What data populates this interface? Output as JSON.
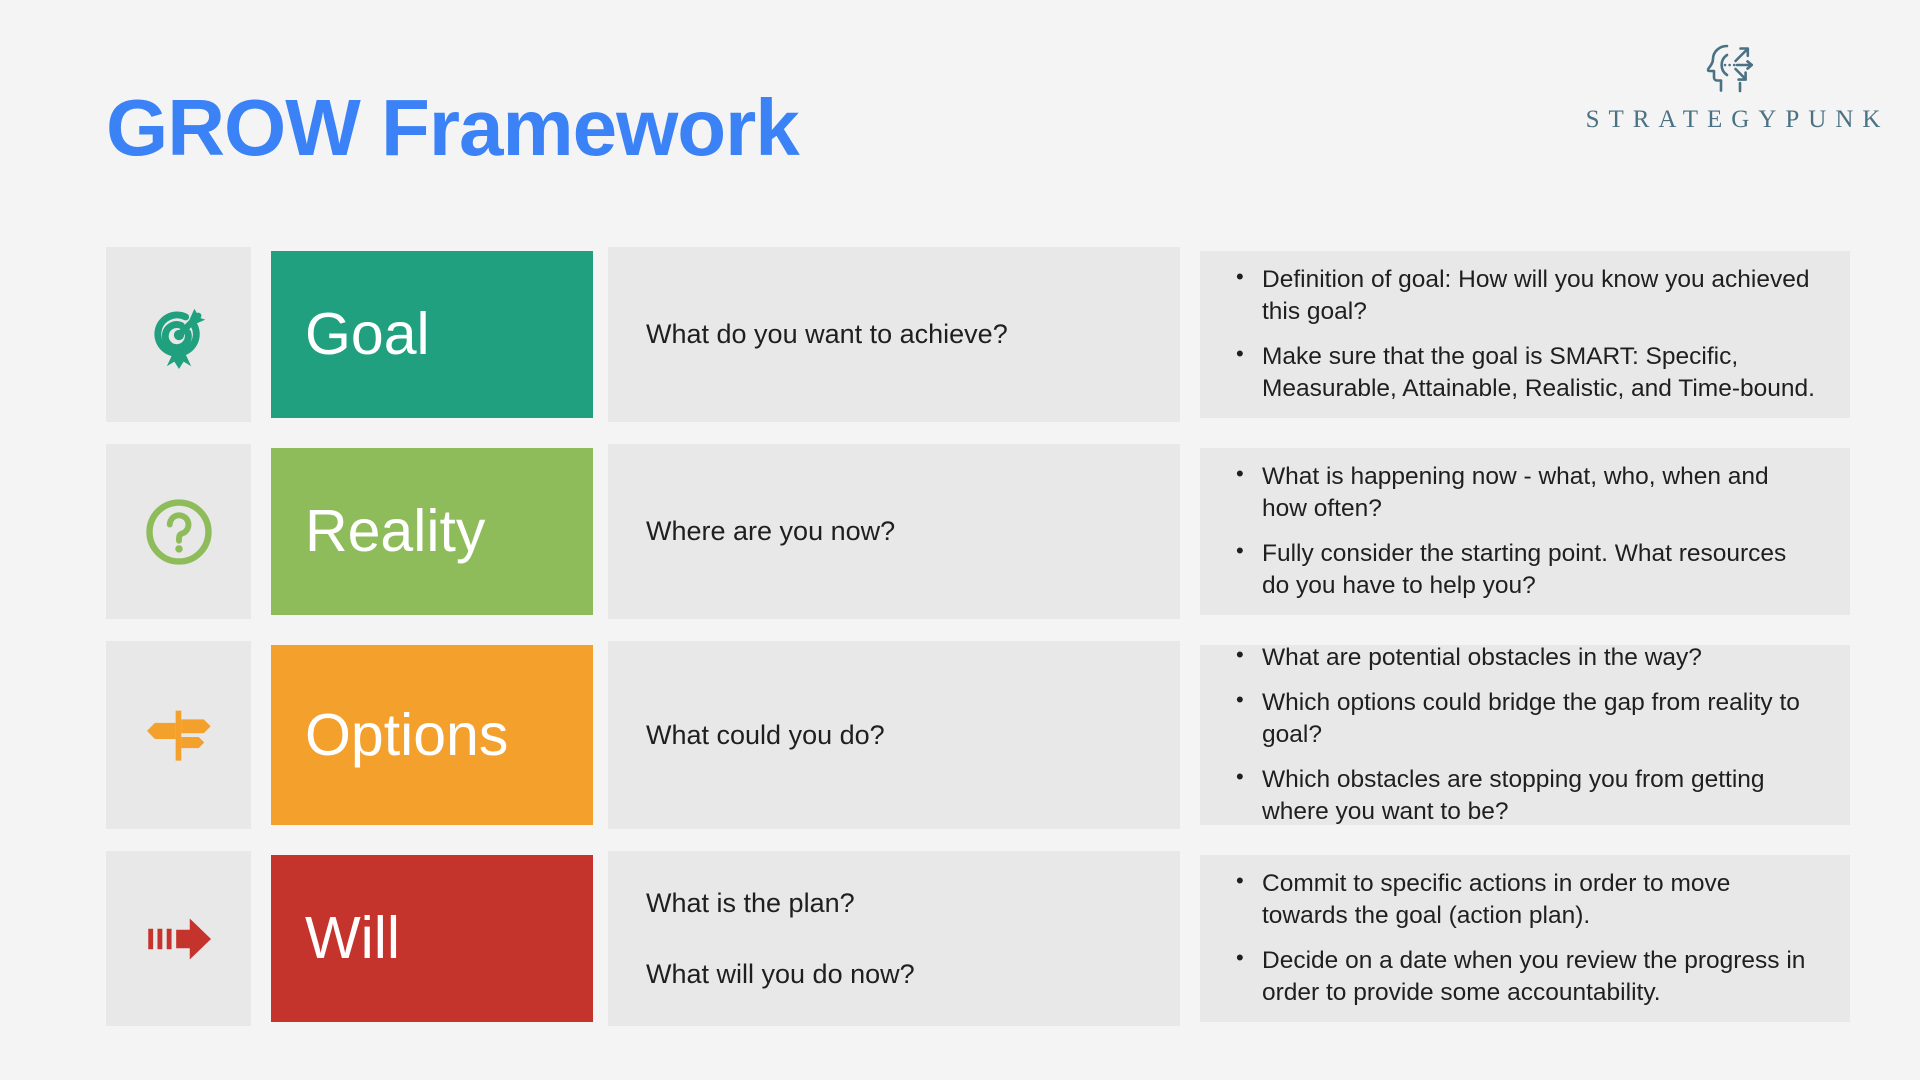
{
  "header": {
    "title": "GROW Framework",
    "title_color": "#3b82f6",
    "brand_name": "STRATEGYPUNK",
    "brand_color": "#4a7184",
    "brand_icon": "head-with-arrows-icon"
  },
  "page": {
    "background_color": "#f4f4f4",
    "panel_color": "#e8e8e8"
  },
  "rows": [
    {
      "key": "goal",
      "label": "Goal",
      "color": "#20a07e",
      "icon": "target-arrow-icon",
      "questions": [
        "What do you want to achieve?"
      ],
      "bullets": [
        "Definition of goal: How will you know you achieved this goal?",
        "Make sure that the goal is SMART: Specific, Measurable, Attainable, Realistic, and Time-bound."
      ]
    },
    {
      "key": "reality",
      "label": "Reality",
      "color": "#8fbc5a",
      "icon": "question-mark-circle-icon",
      "questions": [
        "Where are you now?"
      ],
      "bullets": [
        "What is happening now - what, who, when and how often?",
        "Fully consider the starting point. What resources do you have to help you?"
      ]
    },
    {
      "key": "options",
      "label": "Options",
      "color": "#f3a02c",
      "icon": "signpost-icon",
      "questions": [
        "What could you do?"
      ],
      "bullets": [
        "What are potential obstacles in the way?",
        "Which options could bridge the gap from reality to goal?",
        "Which obstacles are stopping you from getting where you want to be?"
      ]
    },
    {
      "key": "will",
      "label": "Will",
      "color": "#c5342c",
      "icon": "motion-arrow-icon",
      "questions": [
        "What is the plan?",
        "What will you do now?"
      ],
      "bullets": [
        "Commit to specific actions in order to move towards the goal (action plan).",
        "Decide on a date when you review the progress in order to provide some accountability."
      ]
    }
  ]
}
